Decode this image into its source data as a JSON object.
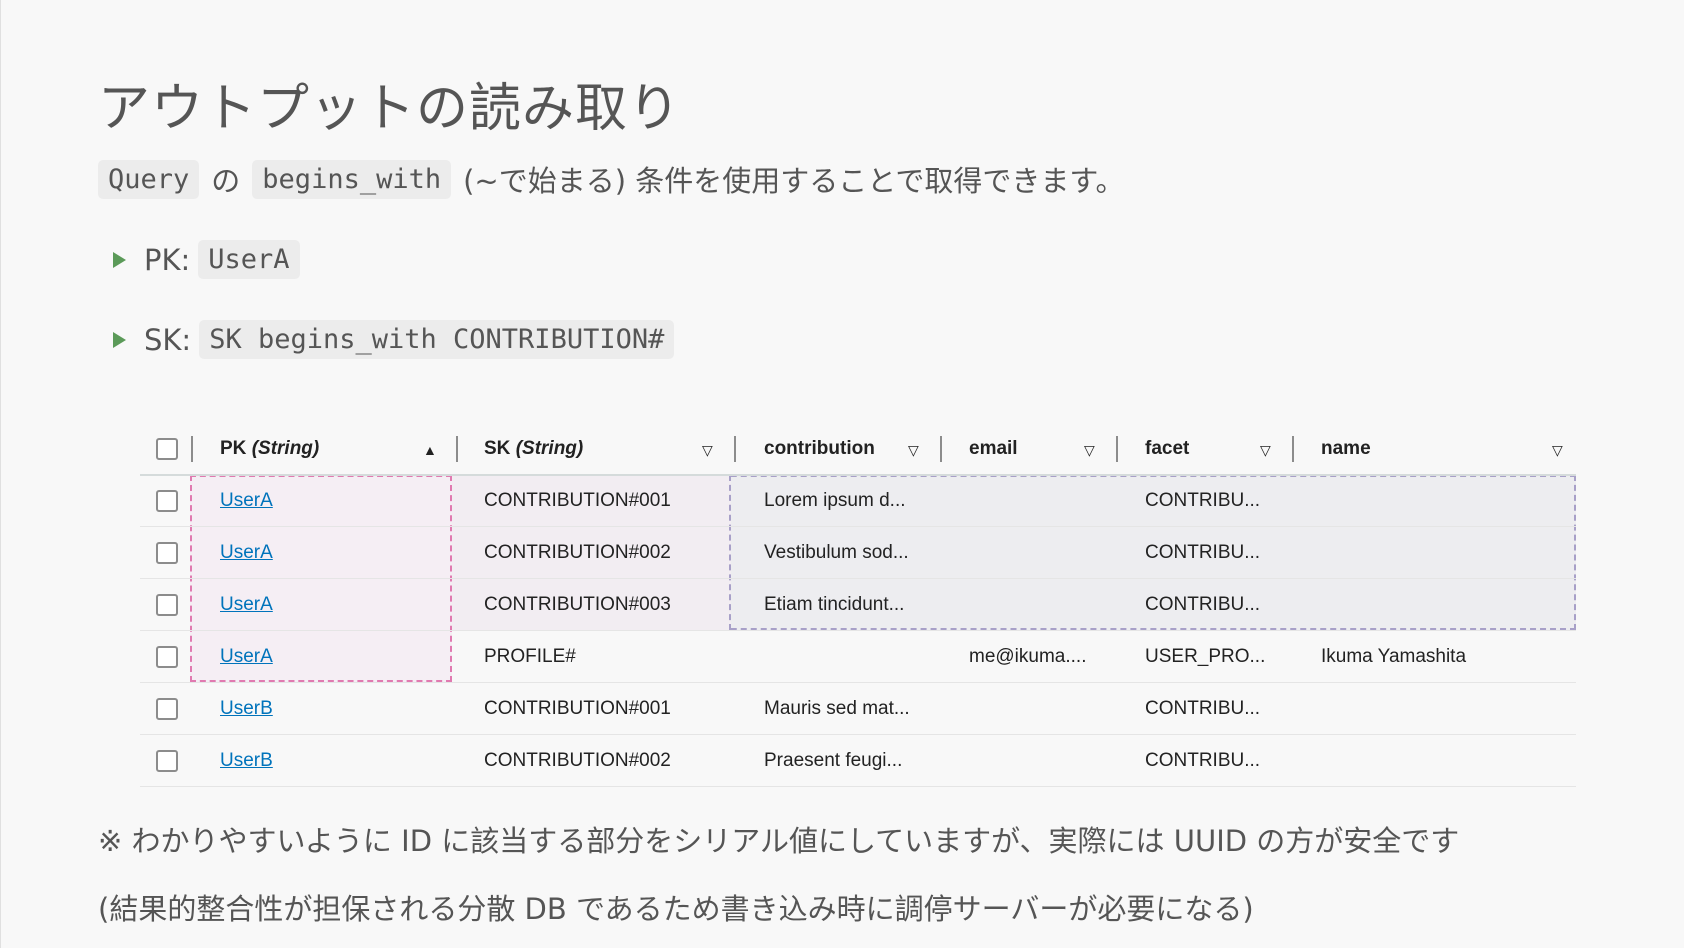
{
  "title": "アウトプットの読み取り",
  "lead": {
    "code1": "Query",
    "particle": "の",
    "code2": "begins_with",
    "rest": "(~で始まる) 条件を使用することで取得できます。"
  },
  "bullets": [
    {
      "label": "PK:",
      "code": "UserA"
    },
    {
      "label": "SK:",
      "code": "SK begins_with CONTRIBUTION#"
    }
  ],
  "table": {
    "headers": {
      "pk": "PK",
      "pk_type": "(String)",
      "sk": "SK",
      "sk_type": "(String)",
      "contribution": "contribution",
      "email": "email",
      "facet": "facet",
      "name": "name"
    },
    "sort_asc_icon": "▲",
    "filter_icon": "▽",
    "rows": [
      {
        "pk": "UserA",
        "sk": "CONTRIBUTION#001",
        "contribution": "Lorem ipsum d...",
        "email": "",
        "facet": "CONTRIBU...",
        "name": ""
      },
      {
        "pk": "UserA",
        "sk": "CONTRIBUTION#002",
        "contribution": "Vestibulum sod...",
        "email": "",
        "facet": "CONTRIBU...",
        "name": ""
      },
      {
        "pk": "UserA",
        "sk": "CONTRIBUTION#003",
        "contribution": "Etiam tincidunt...",
        "email": "",
        "facet": "CONTRIBU...",
        "name": ""
      },
      {
        "pk": "UserA",
        "sk": "PROFILE#",
        "contribution": "",
        "email": "me@ikuma....",
        "facet": "USER_PRO...",
        "name": "Ikuma Yamashita"
      },
      {
        "pk": "UserB",
        "sk": "CONTRIBUTION#001",
        "contribution": "Mauris sed mat...",
        "email": "",
        "facet": "CONTRIBU...",
        "name": ""
      },
      {
        "pk": "UserB",
        "sk": "CONTRIBUTION#002",
        "contribution": "Praesent feugi...",
        "email": "",
        "facet": "CONTRIBU...",
        "name": ""
      }
    ]
  },
  "notes": [
    "※ わかりやすいように ID に該当する部分をシリアル値にしていますが、実際には UUID の方が安全です",
    "(結果的整合性が担保される分散 DB であるため書き込み時に調停サーバーが必要になる)"
  ],
  "colors": {
    "bullet": "#5b9a59",
    "link": "#0073bb",
    "pk_highlight": "#e07ab0",
    "rows_highlight": "#a8a0c8"
  }
}
